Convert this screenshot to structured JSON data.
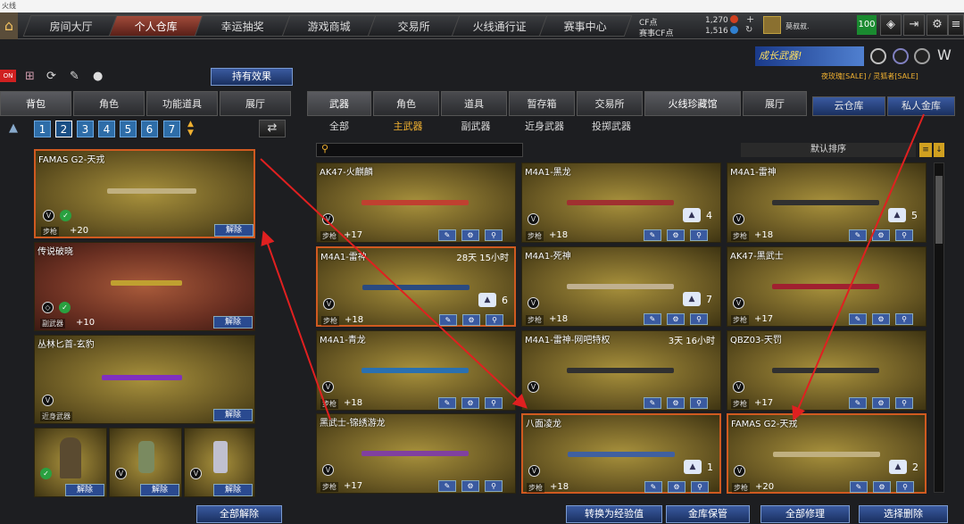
{
  "window": {
    "title": "火线"
  },
  "nav": {
    "tabs": [
      "房间大厅",
      "个人仓库",
      "幸运抽奖",
      "游戏商城",
      "交易所",
      "火线通行证",
      "赛事中心"
    ]
  },
  "currency": {
    "cf_label": "CF点",
    "cf_value": "1,270",
    "event_label": "赛事CF点",
    "event_value": "1,516"
  },
  "user": {
    "name": "莫叔叔.",
    "level": "100"
  },
  "left": {
    "effect_button": "持有效果",
    "tabs": [
      "背包",
      "角色",
      "功能道具",
      "展厅"
    ],
    "pages": [
      "1",
      "2",
      "3",
      "4",
      "5",
      "6",
      "7"
    ],
    "items": [
      {
        "name": "FAMAS G2-天戎",
        "type": "步枪",
        "level": "+20",
        "action": "解除"
      },
      {
        "name": "传说破晓",
        "type": "副武器",
        "level": "+10",
        "action": "解除"
      },
      {
        "name": "丛林匕首-玄豹",
        "type": "近身武器",
        "action": "解除"
      }
    ],
    "small_items": [
      {
        "action": "解除"
      },
      {
        "action": "解除"
      },
      {
        "action": "解除"
      }
    ],
    "remove_all": "全部解除"
  },
  "right": {
    "banner": "成长武器!",
    "sale_text": "夜玫瑰[SALE] / 灵狐者[SALE]",
    "tabs": [
      "武器",
      "角色",
      "道具",
      "暂存箱",
      "交易所",
      "火线珍藏馆",
      "展厅"
    ],
    "vault_tabs": [
      "云仓库",
      "私人金库"
    ],
    "subtabs": [
      "全部",
      "主武器",
      "副武器",
      "近身武器",
      "投掷武器"
    ],
    "sort_label": "默认排序",
    "weapons": [
      {
        "name": "AK47-火麒麟",
        "type": "步枪",
        "level": "+17",
        "time": "",
        "count": "",
        "color": "#c04030"
      },
      {
        "name": "M4A1-黑龙",
        "type": "步枪",
        "level": "+18",
        "time": "",
        "count": "4",
        "color": "#a03030"
      },
      {
        "name": "M4A1-雷神",
        "type": "步枪",
        "level": "+18",
        "time": "",
        "count": "5",
        "color": "#303030"
      },
      {
        "name": "M4A1-雷神",
        "type": "步枪",
        "level": "+18",
        "time": "28天 15小时",
        "count": "6",
        "color": "#2a4a80"
      },
      {
        "name": "M4A1-死神",
        "type": "步枪",
        "level": "+18",
        "time": "",
        "count": "7",
        "color": "#c0b090"
      },
      {
        "name": "AK47-黑武士",
        "type": "步枪",
        "level": "+17",
        "time": "",
        "count": "",
        "color": "#a02030"
      },
      {
        "name": "M4A1-青龙",
        "type": "步枪",
        "level": "+18",
        "time": "",
        "count": "",
        "color": "#2a70b0"
      },
      {
        "name": "M4A1-雷神-网吧特权",
        "type": "",
        "level": "",
        "time": "3天 16小时",
        "count": "",
        "color": "#303030"
      },
      {
        "name": "QBZ03-天罚",
        "type": "步枪",
        "level": "+17",
        "time": "",
        "count": "",
        "color": "#303030"
      },
      {
        "name": "黑武士-锦绣游龙",
        "type": "步枪",
        "level": "+17",
        "time": "",
        "count": "",
        "color": "#8040a0"
      },
      {
        "name": "八面凌龙",
        "type": "步枪",
        "level": "+18",
        "time": "",
        "count": "1",
        "color": "#4060a0"
      },
      {
        "name": "FAMAS G2-天戎",
        "type": "步枪",
        "level": "+20",
        "time": "",
        "count": "2",
        "color": "#c0b080"
      }
    ],
    "bottom_buttons": [
      "转换为经验值",
      "金库保管",
      "全部修理",
      "选择删除"
    ]
  }
}
